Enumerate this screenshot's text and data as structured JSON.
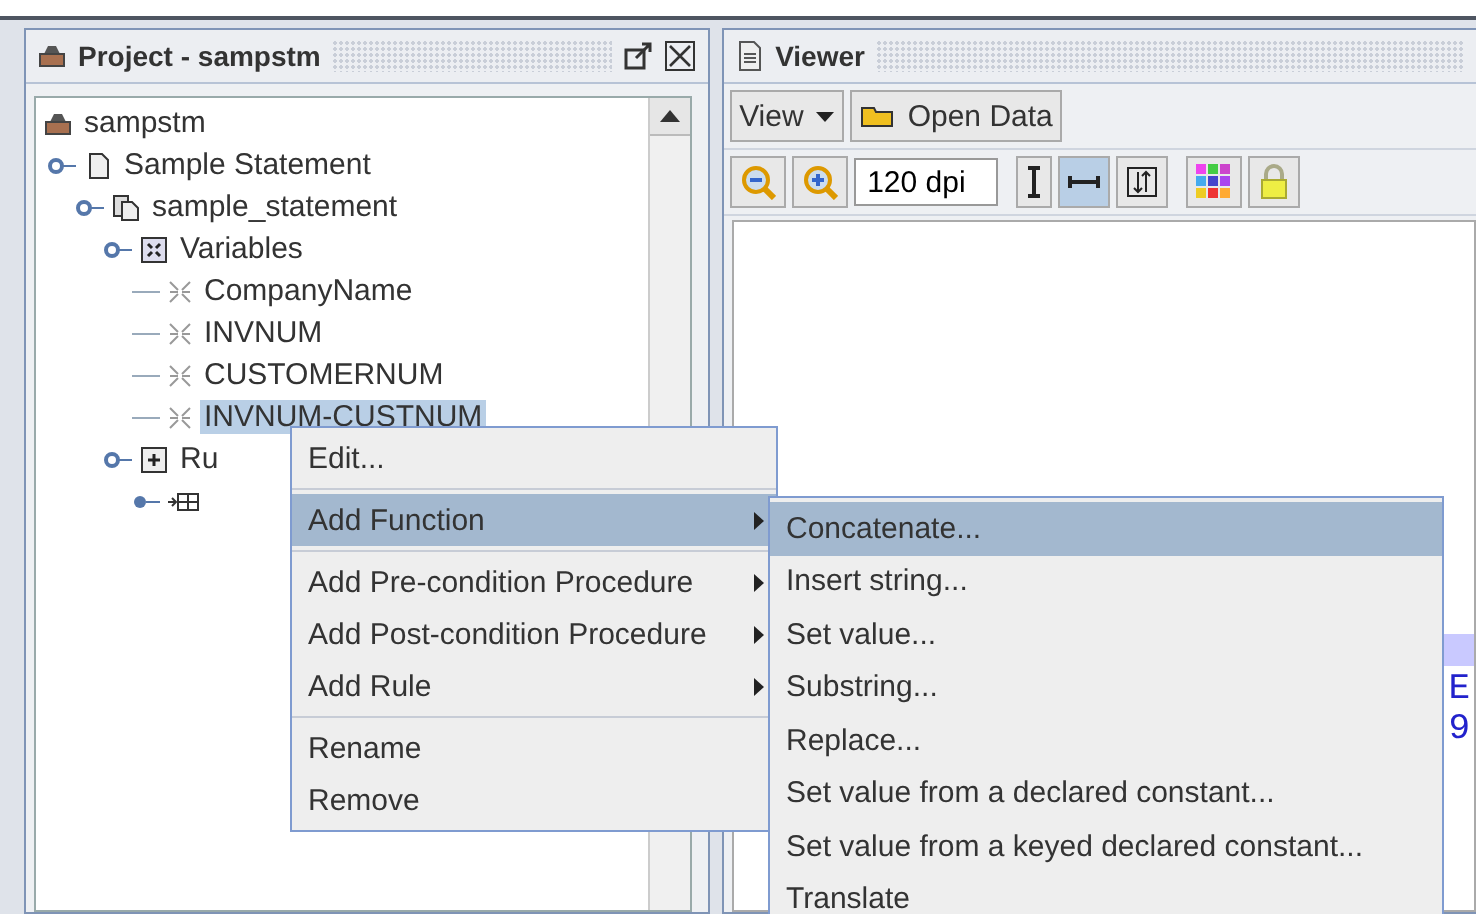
{
  "project_panel": {
    "title": "Project - sampstm",
    "tree": [
      {
        "label": "sampstm",
        "kind": "project",
        "children": [
          {
            "label": "Sample Statement",
            "kind": "document",
            "expanded": true,
            "children": [
              {
                "label": "sample_statement",
                "kind": "documents",
                "expanded": true,
                "children": [
                  {
                    "label": "Variables",
                    "kind": "group",
                    "expanded": true,
                    "children": [
                      {
                        "label": "CompanyName",
                        "kind": "variable",
                        "selected": false
                      },
                      {
                        "label": "INVNUM",
                        "kind": "variable",
                        "selected": false
                      },
                      {
                        "label": "CUSTOMERNUM",
                        "kind": "variable",
                        "selected": false
                      },
                      {
                        "label": "INVNUM-CUSTNUM",
                        "kind": "variable",
                        "selected": true
                      }
                    ]
                  },
                  {
                    "label": "Ru",
                    "kind": "rules",
                    "expanded": true,
                    "children": [
                      {
                        "kind": "rule",
                        "expanded": false
                      }
                    ]
                  }
                ]
              }
            ]
          }
        ]
      }
    ]
  },
  "viewer_panel": {
    "title": "Viewer",
    "view_menu": "View",
    "open_button": "Open Data",
    "dpi": "120 dpi",
    "document_text": [
      "E",
      "9"
    ]
  },
  "context_menu": {
    "groups": [
      [
        {
          "label": "Edit...",
          "submenu": false,
          "selected": false
        }
      ],
      [
        {
          "label": "Add Function",
          "submenu": true,
          "selected": true
        }
      ],
      [
        {
          "label": "Add Pre-condition Procedure",
          "submenu": true,
          "selected": false
        },
        {
          "label": "Add Post-condition Procedure",
          "submenu": true,
          "selected": false
        },
        {
          "label": "Add Rule",
          "submenu": true,
          "selected": false
        }
      ],
      [
        {
          "label": "Rename",
          "submenu": false,
          "selected": false
        },
        {
          "label": "Remove",
          "submenu": false,
          "selected": false
        }
      ]
    ]
  },
  "submenu": [
    {
      "label": "Concatenate...",
      "selected": true
    },
    {
      "label": "Insert string...",
      "selected": false
    },
    {
      "label": "Set value...",
      "selected": false
    },
    {
      "label": "Substring...",
      "selected": false
    },
    {
      "label": "Replace...",
      "selected": false
    },
    {
      "label": "Set value from a declared constant...",
      "selected": false
    },
    {
      "label": "Set value from a keyed declared constant...",
      "selected": false
    },
    {
      "label": "Translate",
      "selected": false
    }
  ]
}
